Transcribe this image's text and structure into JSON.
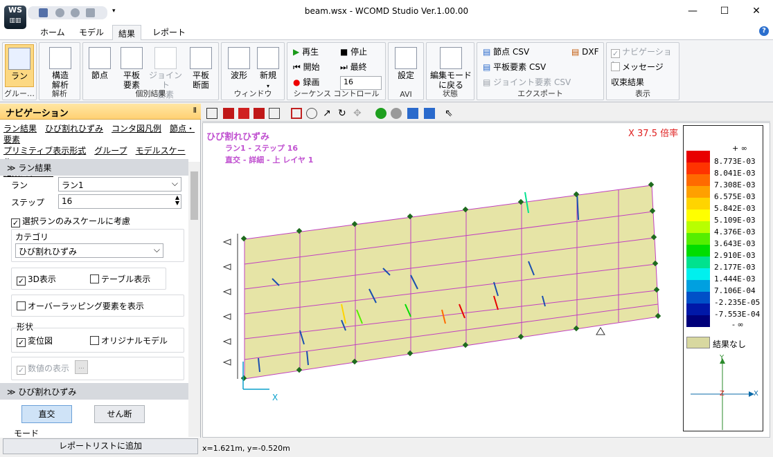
{
  "window": {
    "title": "beam.wsx - WCOMD Studio Ver.1.00.00",
    "logo": "WS",
    "minimize": "—",
    "maximize": "☐",
    "close": "✕"
  },
  "tabs": [
    "ホーム",
    "モデル",
    "結果",
    "レポート"
  ],
  "help": "?",
  "ribbon": {
    "run": {
      "label": "ラン",
      "group": "グルー…"
    },
    "analysis": {
      "label": "構造\n解析",
      "group": "解析"
    },
    "individual": {
      "items": [
        "節点",
        "平板\n要素",
        "ジョイント\n要素",
        "平板\n断面"
      ],
      "group": "個別結果"
    },
    "window": {
      "items": [
        "波形",
        "新規"
      ],
      "group": "ウィンドウ"
    },
    "sequence": {
      "play": "再生",
      "stop": "停止",
      "start": "開始",
      "last": "最終",
      "record": "録画",
      "step": "16",
      "group": "シーケンス コントロール"
    },
    "avi": {
      "label": "設定",
      "group": "AVI"
    },
    "state": {
      "label": "編集モード\nに戻る",
      "group": "状態"
    },
    "export": {
      "node": "節点 CSV",
      "dxf": "DXF",
      "plate": "平板要素 CSV",
      "joint": "ジョイント要素 CSV",
      "group": "エクスポート"
    },
    "display": {
      "nav": "ナビゲーション",
      "msg": "メッセージ",
      "conv": "収束結果",
      "group": "表示"
    }
  },
  "nav": {
    "title": "ナビゲーション",
    "pin": "Ⅱ",
    "links": [
      "ラン結果",
      "ひび割れひずみ",
      "コンタ図凡例",
      "節点・要素",
      "プリミティブ表示形式",
      "グループ",
      "モデルスケール",
      "結果スケール"
    ],
    "run_section": "ラン結果",
    "run_label": "ラン",
    "run_value": "ラン1",
    "step_label": "ステップ",
    "step_value": "16",
    "scale_only": "選択ランのみスケールに考慮",
    "category_label": "カテゴリ",
    "category_value": "ひび割れひずみ",
    "show3d": "3D表示",
    "table": "テーブル表示",
    "overlap": "オーバーラッピング要素を表示",
    "shape_label": "形状",
    "deformed": "変位図",
    "original": "オリジナルモデル",
    "numeric": "数値の表示",
    "dots": "...",
    "crack_section": "ひび割れひずみ",
    "direct": "直交",
    "shear": "せん断",
    "mode": "モード",
    "add_report": "レポートリストに追加"
  },
  "canvas": {
    "caption1": "ひび割れひずみ",
    "caption2": "ラン1 - ステップ 16",
    "caption3": "直交 - 詳細 - 上 レイヤ 1",
    "scale": "X 37.5 倍率",
    "axis_x": "X",
    "status": "x=1.621m, y=-0.520m"
  },
  "legend": {
    "top": "+ ∞",
    "bottom": "- ∞",
    "values": [
      "8.773E-03",
      "8.041E-03",
      "7.308E-03",
      "6.575E-03",
      "5.842E-03",
      "5.109E-03",
      "4.376E-03",
      "3.643E-03",
      "2.910E-03",
      "2.177E-03",
      "1.444E-03",
      "7.106E-04",
      "-2.235E-05",
      "-7.553E-04"
    ],
    "colors": [
      "#e80000",
      "#ff3300",
      "#ff6a00",
      "#ffa000",
      "#ffd400",
      "#ffff00",
      "#b8ff00",
      "#55ee00",
      "#00dd00",
      "#00e28e",
      "#00f0ee",
      "#00a0e0",
      "#0050c8",
      "#0018a8",
      "#00007a"
    ],
    "none": "結果なし",
    "none_color": "#d8d8a0",
    "axis_y": "Y",
    "axis_x": "X",
    "axis_z": "Z"
  }
}
